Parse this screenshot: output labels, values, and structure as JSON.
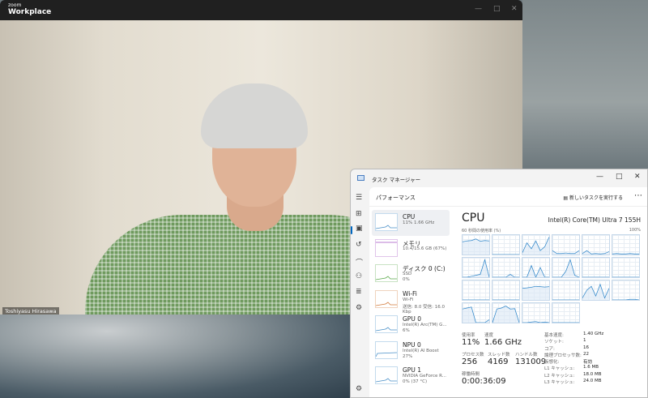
{
  "zoom": {
    "brand": "zoom",
    "app": "Workplace",
    "participant": "Toshiyasu Hirasawa"
  },
  "taskmgr": {
    "title": "タスク マネージャー",
    "page": "パフォーマンス",
    "new_task": "新しいタスクを実行する",
    "items": [
      {
        "name": "CPU",
        "sub1": "11%  1.66 GHz",
        "sub2": "",
        "color": "#4a90c8"
      },
      {
        "name": "メモリ",
        "sub1": "10.4/15.6 GB (67%)",
        "sub2": "",
        "color": "#a24fc0"
      },
      {
        "name": "ディスク 0 (C:)",
        "sub1": "SSD",
        "sub2": "0%",
        "color": "#5aa94a"
      },
      {
        "name": "Wi-Fi",
        "sub1": "Wi-Fi",
        "sub2": "送信: 8.0  受信: 16.0 Kbp",
        "color": "#d27a3a"
      },
      {
        "name": "GPU 0",
        "sub1": "Intel(R) Arc(TM) G...",
        "sub2": "6%",
        "color": "#4a90c8"
      },
      {
        "name": "NPU 0",
        "sub1": "Intel(R) AI Boost",
        "sub2": "27%",
        "color": "#4a90c8"
      },
      {
        "name": "GPU 1",
        "sub1": "NVIDIA GeForce R...",
        "sub2": "0% (37 °C)",
        "color": "#4a90c8"
      }
    ],
    "cpu": {
      "title": "CPU",
      "model": "Intel(R) Core(TM) Ultra 7 155H",
      "caption": "60 秒間の使用率 (%)",
      "max": "100%",
      "cores": [
        [
          65,
          70,
          72,
          80,
          68,
          72,
          70
        ],
        [
          0,
          0,
          0,
          0,
          0,
          0,
          0
        ],
        [
          10,
          60,
          30,
          70,
          20,
          40,
          90
        ],
        [
          20,
          5,
          5,
          8,
          5,
          5,
          20
        ],
        [
          5,
          20,
          3,
          5,
          3,
          5,
          15
        ],
        [
          3,
          5,
          3,
          3,
          5,
          3,
          3
        ],
        [
          0,
          0,
          5,
          10,
          15,
          90,
          0
        ],
        [
          0,
          0,
          0,
          0,
          15,
          0,
          0
        ],
        [
          0,
          0,
          60,
          0,
          50,
          0,
          0
        ],
        [
          0,
          0,
          0,
          30,
          90,
          10,
          0
        ],
        [
          0,
          0,
          0,
          0,
          0,
          0,
          0
        ],
        [
          0,
          0,
          0,
          0,
          0,
          0,
          0
        ],
        [
          0,
          0,
          0,
          0,
          0,
          0,
          0
        ],
        [
          0,
          0,
          0,
          0,
          0,
          0,
          0
        ],
        [
          60,
          62,
          65,
          70,
          68,
          66,
          68
        ],
        [
          0,
          0,
          0,
          0,
          0,
          0,
          0
        ],
        [
          10,
          50,
          70,
          20,
          80,
          10,
          60
        ],
        [
          0,
          0,
          0,
          0,
          3,
          3,
          0
        ],
        [
          70,
          75,
          80,
          0,
          0,
          0,
          15
        ],
        [
          0,
          70,
          75,
          85,
          70,
          72,
          0
        ],
        [
          0,
          0,
          3,
          5,
          0,
          3,
          0
        ],
        [
          0,
          0,
          0,
          0,
          0,
          0,
          0
        ]
      ],
      "stats": [
        {
          "label": "使用率",
          "value": "11%"
        },
        {
          "label": "速度",
          "value": "1.66 GHz"
        },
        {
          "label": "プロセス数",
          "value": "256"
        },
        {
          "label": "スレッド数",
          "value": "4169"
        },
        {
          "label": "ハンドル数",
          "value": "131009"
        },
        {
          "label": "稼働時間",
          "value": "0:00:36:09"
        }
      ],
      "specs": [
        {
          "k": "基本速度:",
          "v": "1.40 GHz"
        },
        {
          "k": "ソケット:",
          "v": "1"
        },
        {
          "k": "コア:",
          "v": "16"
        },
        {
          "k": "論理プロセッサ数:",
          "v": "22"
        },
        {
          "k": "仮想化:",
          "v": "有効"
        },
        {
          "k": "L1 キャッシュ:",
          "v": "1.6 MB"
        },
        {
          "k": "L2 キャッシュ:",
          "v": "18.0 MB"
        },
        {
          "k": "L3 キャッシュ:",
          "v": "24.0 MB"
        }
      ]
    }
  }
}
